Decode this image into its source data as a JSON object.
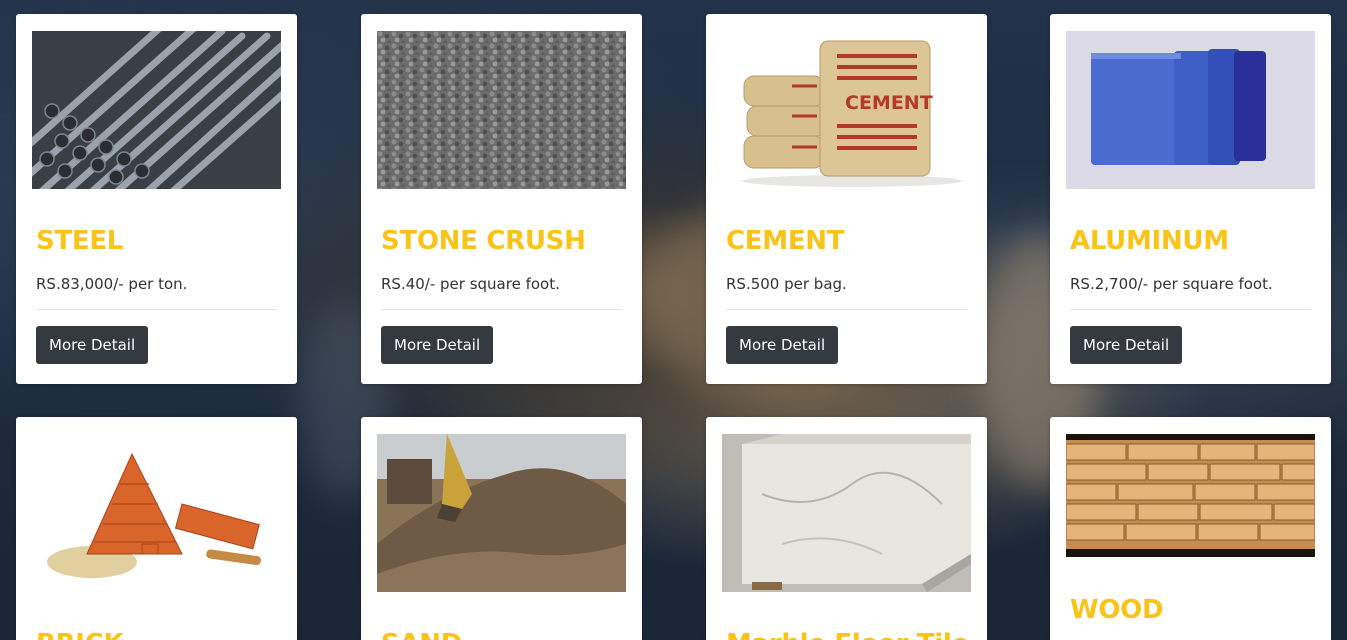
{
  "colors": {
    "title": "#f9c31a",
    "button_bg": "#343a40",
    "button_text": "#ffffff",
    "card_bg": "#ffffff"
  },
  "products": [
    {
      "title": "STEEL",
      "price": "RS.83,000/- per ton.",
      "button": "More Detail",
      "image": "steel-rebar-image"
    },
    {
      "title": "STONE CRUSH",
      "price": "RS.40/- per square foot.",
      "button": "More Detail",
      "image": "stone-crush-image"
    },
    {
      "title": "CEMENT",
      "price": "RS.500 per bag.",
      "button": "More Detail",
      "image": "cement-bags-image"
    },
    {
      "title": "ALUMINUM",
      "price": "RS.2,700/- per square foot.",
      "button": "More Detail",
      "image": "aluminum-panels-image"
    },
    {
      "title": "BRICK",
      "image": "bricks-image"
    },
    {
      "title": "SAND",
      "image": "sand-pile-image"
    },
    {
      "title": "Marble Floor Tile",
      "image": "marble-slabs-image"
    },
    {
      "title": "WOOD",
      "image": "wood-planks-image"
    }
  ]
}
